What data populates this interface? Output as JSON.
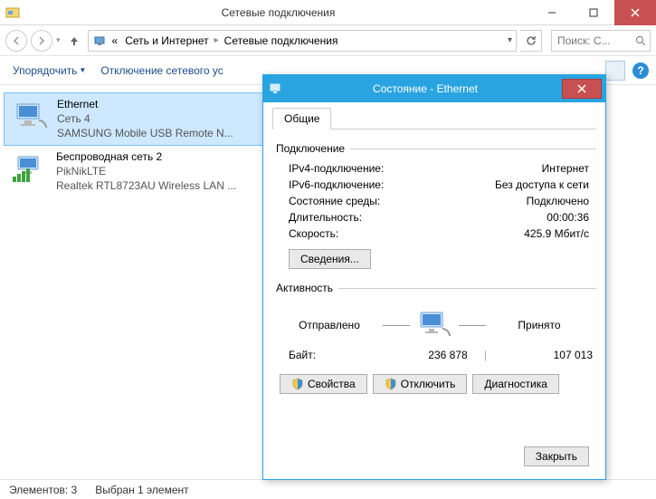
{
  "window": {
    "title": "Сетевые подключения",
    "breadcrumb_prefix": "«",
    "breadcrumb1": "Сеть и Интернет",
    "breadcrumb2": "Сетевые подключения",
    "search_placeholder": "Поиск: С..."
  },
  "toolbar": {
    "organize": "Упорядочить",
    "disable": "Отключение сетевого ус"
  },
  "items": [
    {
      "name": "Ethernet",
      "net": "Сеть 4",
      "device": "SAMSUNG Mobile USB Remote N..."
    },
    {
      "name": "Беспроводная сеть 2",
      "net": "PikNikLTE",
      "device": "Realtek RTL8723AU Wireless LAN ..."
    }
  ],
  "statusbar": {
    "count": "Элементов: 3",
    "selected": "Выбран 1 элемент"
  },
  "dialog": {
    "title": "Состояние - Ethernet",
    "tab": "Общие",
    "section_conn": "Подключение",
    "ipv4_k": "IPv4-подключение:",
    "ipv4_v": "Интернет",
    "ipv6_k": "IPv6-подключение:",
    "ipv6_v": "Без доступа к сети",
    "media_k": "Состояние среды:",
    "media_v": "Подключено",
    "dur_k": "Длительность:",
    "dur_v": "00:00:36",
    "speed_k": "Скорость:",
    "speed_v": "425.9 Мбит/с",
    "details_btn": "Сведения...",
    "section_act": "Активность",
    "sent": "Отправлено",
    "recv": "Принято",
    "bytes_lbl": "Байт:",
    "bytes_sent": "236 878",
    "bytes_recv": "107 013",
    "btn_props": "Свойства",
    "btn_disable": "Отключить",
    "btn_diag": "Диагностика",
    "btn_close": "Закрыть"
  }
}
